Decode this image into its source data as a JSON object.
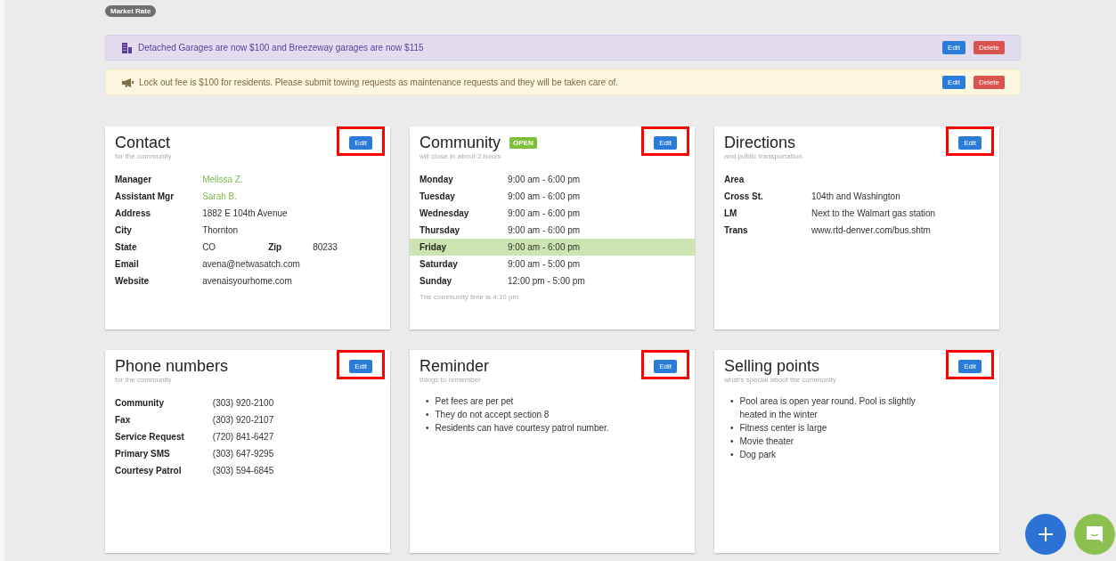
{
  "market_badge": "Market Rate",
  "alerts": [
    {
      "kind": "garage",
      "text": "Detached Garages are now $100 and Breezeway garages are now $115",
      "buttons": [
        "Edit",
        "Delete"
      ]
    },
    {
      "kind": "announcement",
      "text": "Lock out fee is $100 for residents. Please submit towing requests as maintenance requests and they will be taken care of.",
      "buttons": [
        "Edit",
        "Delete"
      ]
    }
  ],
  "cards": [
    {
      "kind": "details",
      "title": "Contact",
      "subtitle": "for the community",
      "edit": "Edit",
      "highlighted": true,
      "rows": [
        {
          "label": "Manager",
          "value": "Melissa Z.",
          "kind": "link"
        },
        {
          "label": "Assistant Mgr",
          "value": "Sarah B.",
          "kind": "link"
        },
        {
          "label": "Address",
          "value": "1882 E 104th Avenue",
          "kind": "text"
        },
        {
          "label": "City",
          "value": "Thornton",
          "kind": "text"
        },
        {
          "label": "State",
          "value": "CO",
          "kind": "pair",
          "second_label": "Zip",
          "second_value": "80233"
        },
        {
          "label": "Email",
          "value": "avena@netwasatch.com",
          "kind": "text"
        },
        {
          "label": "Website",
          "value": "avenaisyourhome.com",
          "kind": "text"
        }
      ]
    },
    {
      "kind": "hours",
      "title": "Community",
      "badge": "OPEN",
      "subtitle": "will close in about 2 hours",
      "edit": "Edit",
      "highlighted": true,
      "rows": [
        {
          "day": "Monday",
          "hours": "9:00 am - 6:00 pm",
          "selected": false
        },
        {
          "day": "Tuesday",
          "hours": "9:00 am - 6:00 pm",
          "selected": false
        },
        {
          "day": "Wednesday",
          "hours": "9:00 am - 6:00 pm",
          "selected": false
        },
        {
          "day": "Thursday",
          "hours": "9:00 am - 6:00 pm",
          "selected": false
        },
        {
          "day": "Friday",
          "hours": "9:00 am - 6:00 pm",
          "selected": true
        },
        {
          "day": "Saturday",
          "hours": "9:00 am - 5:00 pm",
          "selected": false
        },
        {
          "day": "Sunday",
          "hours": "12:00 pm - 5:00 pm",
          "selected": false
        }
      ],
      "note": "The community time is 4:10 pm"
    },
    {
      "kind": "details",
      "title": "Directions",
      "subtitle": "and public transportation",
      "edit": "Edit",
      "highlighted": true,
      "rows": [
        {
          "label": "Area",
          "kind": "text"
        },
        {
          "label": "Cross St.",
          "value": "104th and Washington",
          "kind": "text"
        },
        {
          "label": "LM",
          "value": "Next to the Walmart gas station",
          "kind": "text"
        },
        {
          "label": "Trans",
          "value": "www.rtd-denver.com/bus.shtm",
          "kind": "text"
        }
      ]
    },
    {
      "kind": "details",
      "title": "Phone numbers",
      "subtitle": "for the community",
      "edit": "Edit",
      "highlighted": true,
      "rows": [
        {
          "label": "Community",
          "value": "(303) 920-2100",
          "kind": "text"
        },
        {
          "label": "Fax",
          "value": "(303) 920-2107",
          "kind": "text"
        },
        {
          "label": "Service Request",
          "value": "(720) 841-6427",
          "kind": "text"
        },
        {
          "label": "Primary SMS",
          "value": "(303) 647-9295",
          "kind": "text"
        },
        {
          "label": "Courtesy Patrol",
          "value": "(303) 594-6845",
          "kind": "text"
        }
      ]
    },
    {
      "kind": "list",
      "title": "Reminder",
      "subtitle": "things to remember",
      "edit": "Edit",
      "highlighted": true,
      "bullet": "•",
      "items": [
        "Pet fees are per pet",
        "They do not accept section 8",
        "Residents can have courtesy patrol number."
      ]
    },
    {
      "kind": "list",
      "title": "Selling points",
      "subtitle": "what's special about the community",
      "edit": "Edit",
      "highlighted": true,
      "bullet": "•",
      "items": [
        "Pool area is open year round. Pool is slightly heated in the winter",
        "Fitness center is large",
        "Movie theater",
        "Dog park"
      ]
    }
  ],
  "fabs": [
    {
      "kind": "add"
    },
    {
      "kind": "chat"
    }
  ]
}
